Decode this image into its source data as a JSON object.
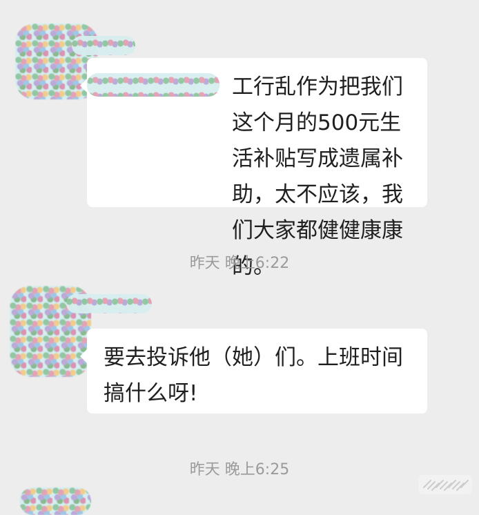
{
  "messages": [
    {
      "sender_label": "",
      "text": "工行乱作为把我们这个月的500元生活补贴写成遗属补助，太不应该，我们大家都健健康康的。"
    },
    {
      "sender_label": "",
      "text": "要去投诉他（她）们。上班时间搞什么呀!"
    }
  ],
  "timestamps": [
    "昨天 晚上6:22",
    "昨天 晚上6:25"
  ],
  "watermark": {
    "icon": "watermark-icon"
  }
}
